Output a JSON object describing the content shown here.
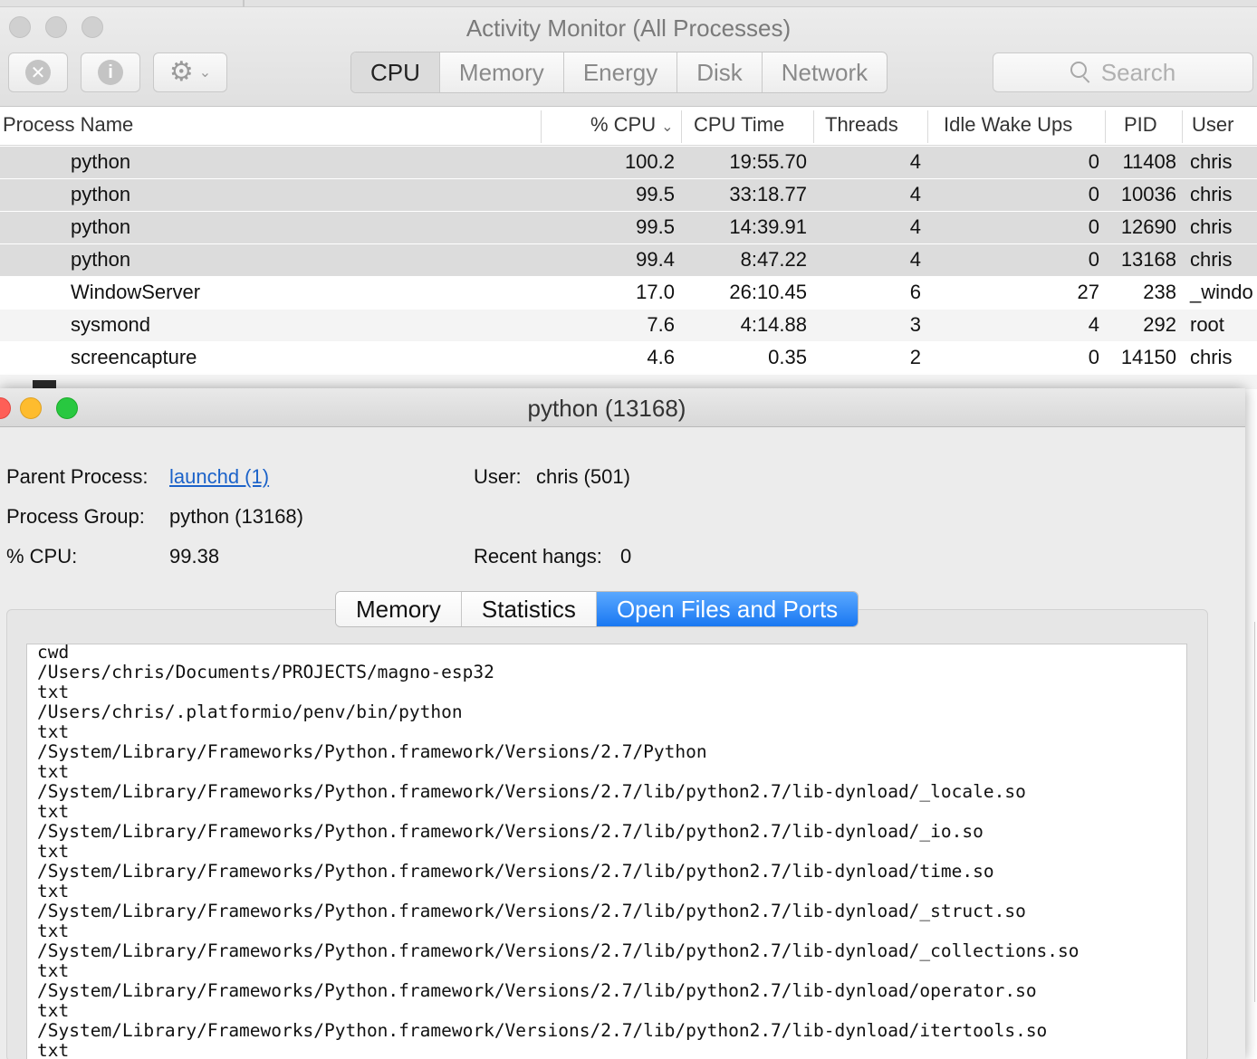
{
  "app": {
    "title": "Activity Monitor (All Processes)"
  },
  "toolbar": {
    "stop_icon": "stop-process-icon",
    "info_icon": "inspect-process-icon",
    "gear_icon": "gear-icon",
    "tabs": [
      "CPU",
      "Memory",
      "Energy",
      "Disk",
      "Network"
    ],
    "active_tab": "CPU",
    "search_placeholder": "Search"
  },
  "columns": {
    "process_name": "Process Name",
    "cpu_pct": "% CPU",
    "cpu_time": "CPU Time",
    "threads": "Threads",
    "idle_wake_ups": "Idle Wake Ups",
    "pid": "PID",
    "user": "User",
    "sort_indicator": "chevron-down-icon"
  },
  "processes": [
    {
      "name": "python",
      "cpu": "100.2",
      "cpu_time": "19:55.70",
      "threads": "4",
      "idle": "0",
      "pid": "11408",
      "user": "chris"
    },
    {
      "name": "python",
      "cpu": "99.5",
      "cpu_time": "33:18.77",
      "threads": "4",
      "idle": "0",
      "pid": "10036",
      "user": "chris"
    },
    {
      "name": "python",
      "cpu": "99.5",
      "cpu_time": "14:39.91",
      "threads": "4",
      "idle": "0",
      "pid": "12690",
      "user": "chris"
    },
    {
      "name": "python",
      "cpu": "99.4",
      "cpu_time": "8:47.22",
      "threads": "4",
      "idle": "0",
      "pid": "13168",
      "user": "chris"
    },
    {
      "name": "WindowServer",
      "cpu": "17.0",
      "cpu_time": "26:10.45",
      "threads": "6",
      "idle": "27",
      "pid": "238",
      "user": "_windo"
    },
    {
      "name": "sysmond",
      "cpu": "7.6",
      "cpu_time": "4:14.88",
      "threads": "3",
      "idle": "4",
      "pid": "292",
      "user": "root"
    },
    {
      "name": "screencapture",
      "cpu": "4.6",
      "cpu_time": "0.35",
      "threads": "2",
      "idle": "0",
      "pid": "14150",
      "user": "chris"
    }
  ],
  "inspector": {
    "title": "python (13168)",
    "parent_process_label": "Parent Process:",
    "parent_process_value": "launchd (1)",
    "process_group_label": "Process Group:",
    "process_group_value": "python (13168)",
    "cpu_label": "% CPU:",
    "cpu_value": "99.38",
    "user_label": "User:",
    "user_value": "chris (501)",
    "recent_hangs_label": "Recent hangs:",
    "recent_hangs_value": "0",
    "tabs": [
      "Memory",
      "Statistics",
      "Open Files and Ports"
    ],
    "active_tab": "Open Files and Ports",
    "open_files": [
      "cwd",
      "/Users/chris/Documents/PROJECTS/magno-esp32",
      "txt",
      "/Users/chris/.platformio/penv/bin/python",
      "txt",
      "/System/Library/Frameworks/Python.framework/Versions/2.7/Python",
      "txt",
      "/System/Library/Frameworks/Python.framework/Versions/2.7/lib/python2.7/lib-dynload/_locale.so",
      "txt",
      "/System/Library/Frameworks/Python.framework/Versions/2.7/lib/python2.7/lib-dynload/_io.so",
      "txt",
      "/System/Library/Frameworks/Python.framework/Versions/2.7/lib/python2.7/lib-dynload/time.so",
      "txt",
      "/System/Library/Frameworks/Python.framework/Versions/2.7/lib/python2.7/lib-dynload/_struct.so",
      "txt",
      "/System/Library/Frameworks/Python.framework/Versions/2.7/lib/python2.7/lib-dynload/_collections.so",
      "txt",
      "/System/Library/Frameworks/Python.framework/Versions/2.7/lib/python2.7/lib-dynload/operator.so",
      "txt",
      "/System/Library/Frameworks/Python.framework/Versions/2.7/lib/python2.7/lib-dynload/itertools.so",
      "txt"
    ]
  },
  "colors": {
    "traffic_red": "#fe5f57",
    "traffic_yellow": "#febc2e",
    "traffic_green": "#28c840",
    "accent_blue": "#1a78f2",
    "link": "#1b62c9"
  }
}
